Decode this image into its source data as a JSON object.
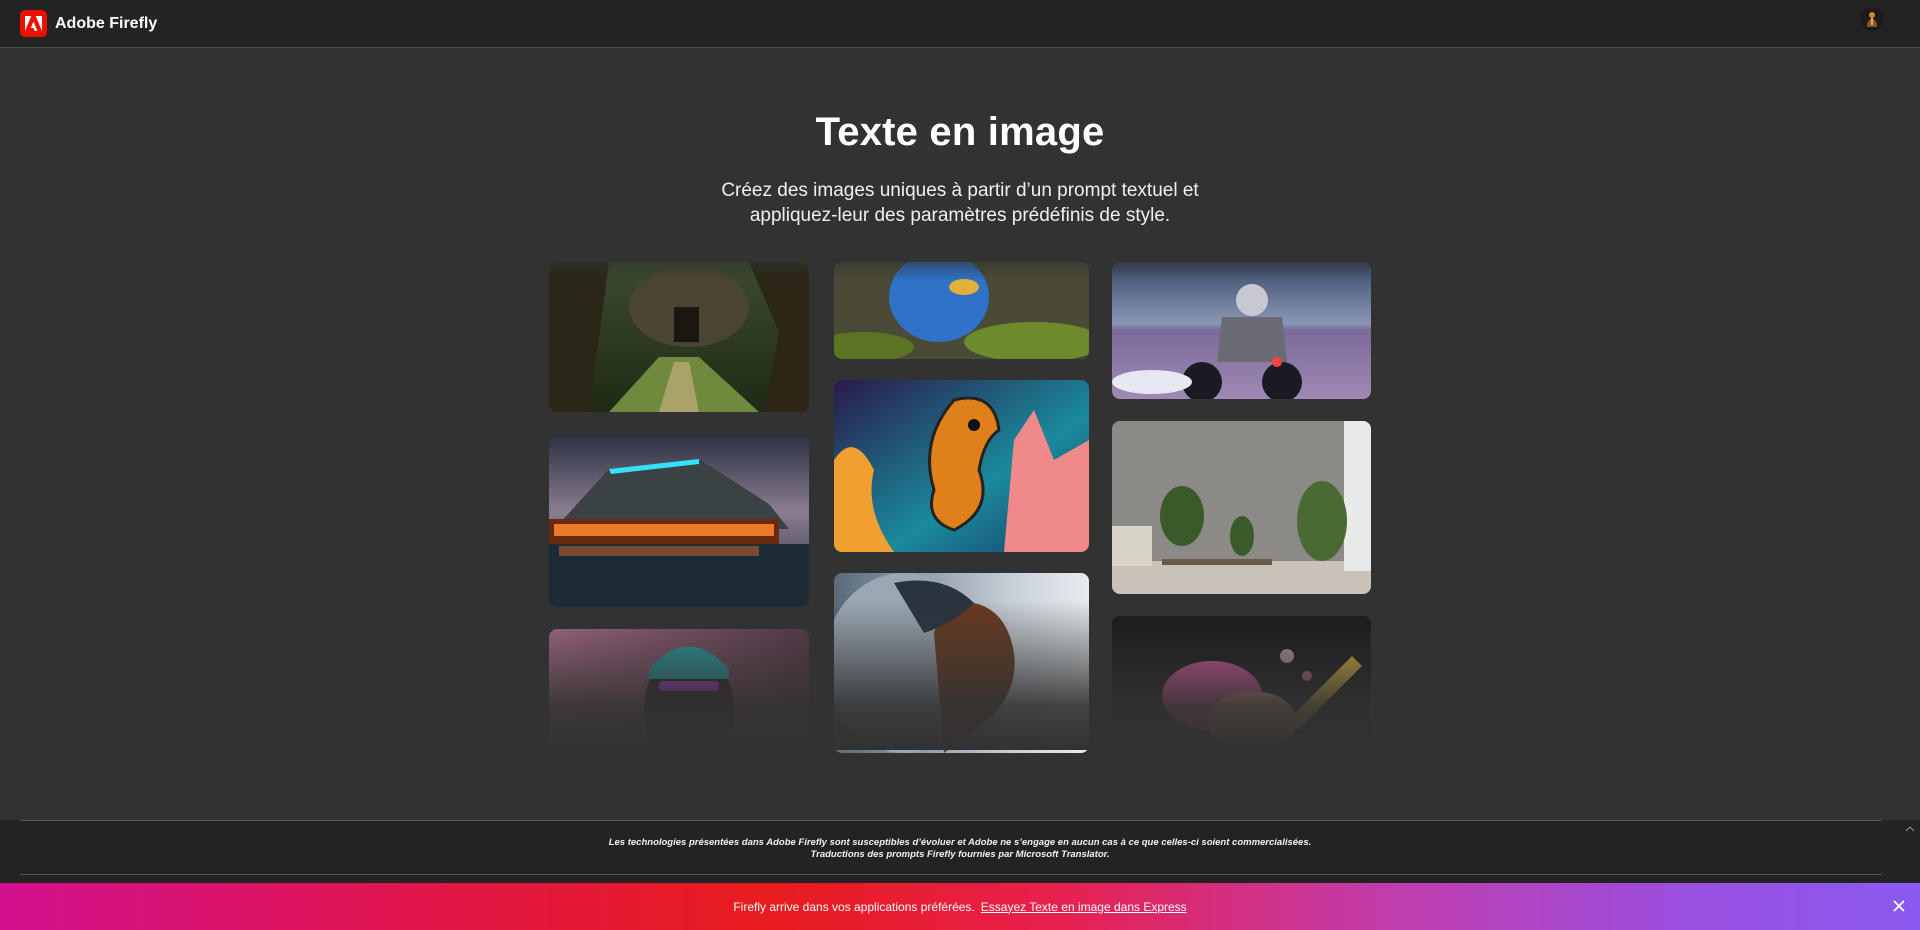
{
  "header": {
    "brand": "Adobe Firefly",
    "logo_icon": "adobe-logo-icon",
    "avatar_icon": "user-avatar-icon"
  },
  "hero": {
    "title": "Texte en image",
    "subtitle_line1": "Créez des images uniques à partir d’un prompt textuel et",
    "subtitle_line2": "appliquez-leur des paramètres prédéfinis de style."
  },
  "gallery": {
    "images": [
      "enchanted-forest-tree-house",
      "blue-fluffy-creature-on-moss",
      "astronaut-on-motorcycle",
      "neon-lit-lodge-by-lake",
      "coral-seahorse",
      "indoor-plants-living-room",
      "person-with-neon-beanie",
      "woman-profile-with-clouds",
      "colorful-powder-explosion"
    ]
  },
  "footer": {
    "disclaimer_line1": "Les technologies présentées dans Adobe Firefly sont susceptibles d’évoluer et Adobe ne s’engage en aucun cas à ce que celles-ci soient commercialisées.",
    "disclaimer_line2": "Traductions des prompts Firefly fournies par Microsoft Translator."
  },
  "banner": {
    "text": "Firefly arrive dans vos applications préférées.",
    "link": "Essayez Texte en image dans Express",
    "close_icon": "close-icon"
  }
}
